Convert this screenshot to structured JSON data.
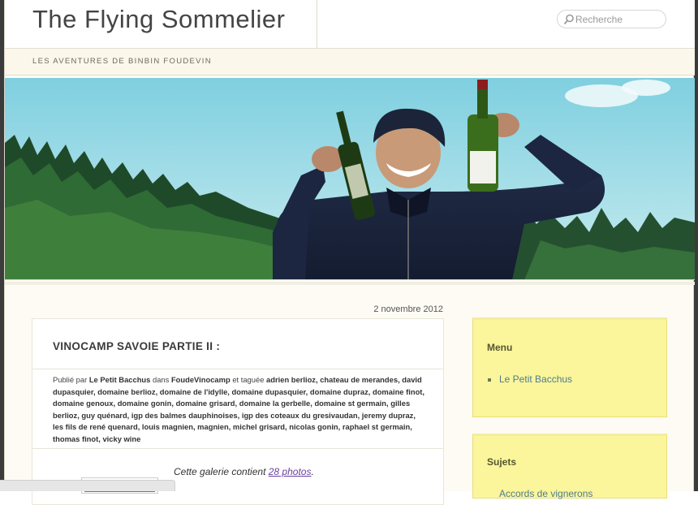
{
  "site": {
    "title": "The Flying Sommelier",
    "tagline": "LES AVENTURES DE BINBIN FOUDEVIN"
  },
  "search": {
    "placeholder": "Recherche"
  },
  "post": {
    "date": "2 novembre 2012",
    "title": "VINOCAMP SAVOIE PARTIE II :",
    "meta_published_prefix": "Publié par",
    "author": "Le Petit Bacchus",
    "meta_in": "dans",
    "category": "FoudeVinocamp",
    "meta_tagged": "et taguée",
    "tags": "adrien berlioz, chateau de merandes, david dupasquier, domaine berlioz, domaine de l'idylle, domaine dupasquier, domaine dupraz, domaine finot, domaine genoux, domaine gonin, domaine grisard, domaine la gerbelle, domaine st germain, gilles berlioz, guy quénard, igp des balmes dauphinoises, igp des coteaux du gresivaudan, jeremy dupraz, les fils de rené quenard, louis magnien, magnien, michel grisard, nicolas gonin, raphael st germain, thomas finot, vicky wine",
    "gallery_prefix": "Cette galerie contient ",
    "gallery_link": "28 photos",
    "gallery_suffix": "."
  },
  "sidebar": {
    "menu_title": "Menu",
    "menu_items": [
      {
        "label": "Le Petit Bacchus"
      }
    ],
    "subjects_title": "Sujets",
    "subjects_first_item": "Accords de vignerons"
  },
  "colors": {
    "widget_bg": "#fbf59b",
    "link": "#4f7d8c",
    "visited_link": "#6b3fa0"
  }
}
